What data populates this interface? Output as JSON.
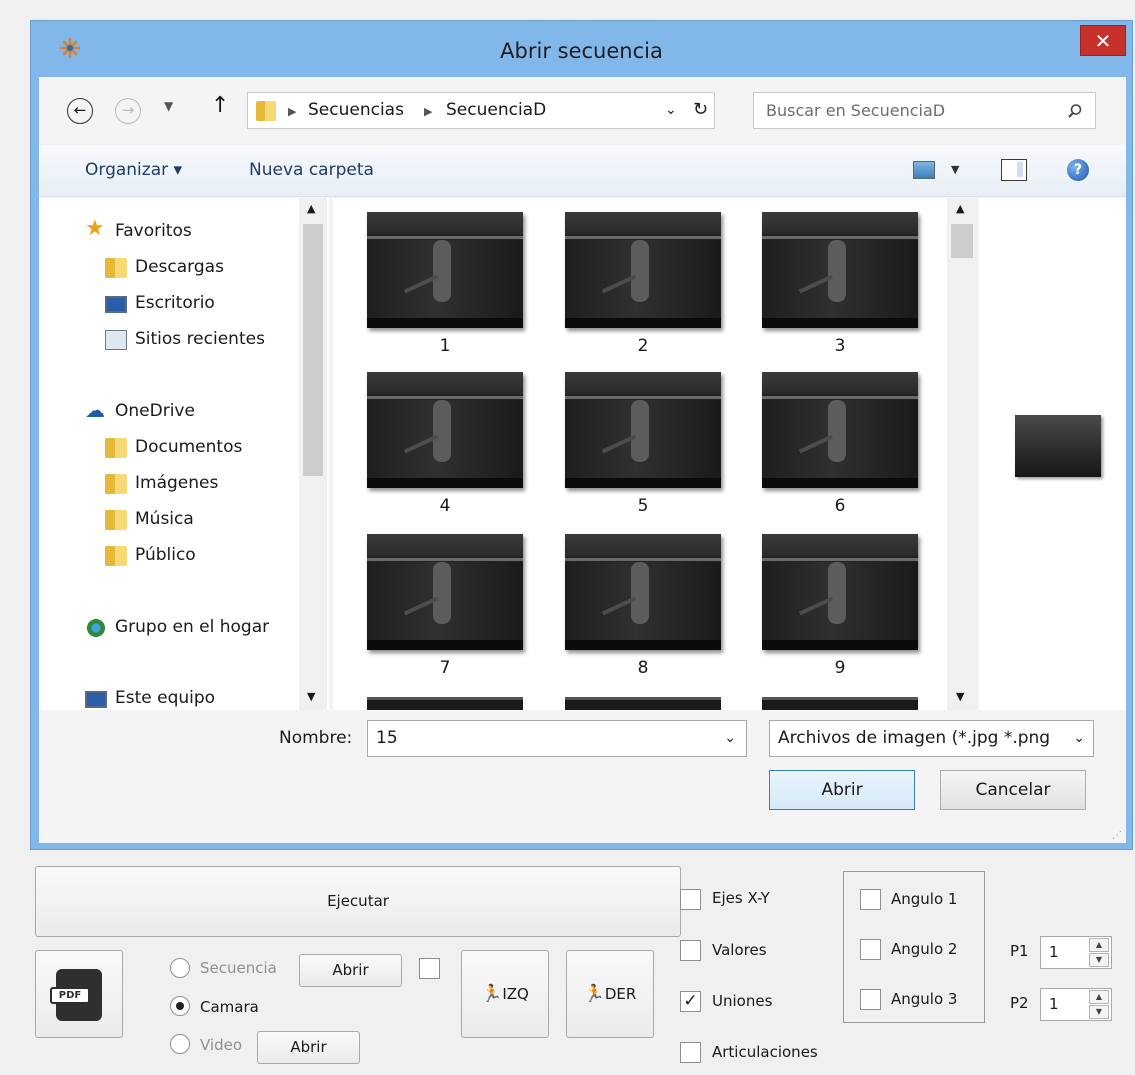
{
  "dialog": {
    "title": "Abrir secuencia",
    "close_label": "✕",
    "breadcrumb": [
      "Secuencias",
      "SecuenciaD"
    ],
    "search": {
      "placeholder": "Buscar en SecuenciaD"
    },
    "toolbar": {
      "organize": "Organizar ▾",
      "new_folder": "Nueva carpeta"
    },
    "nav": {
      "favorites": "Favoritos",
      "downloads": "Descargas",
      "desktop": "Escritorio",
      "recent": "Sitios recientes",
      "onedrive": "OneDrive",
      "documents": "Documentos",
      "images": "Imágenes",
      "music": "Música",
      "public": "Público",
      "homegroup": "Grupo en el hogar",
      "this_pc": "Este equipo"
    },
    "files": [
      "1",
      "2",
      "3",
      "4",
      "5",
      "6",
      "7",
      "8",
      "9"
    ],
    "filename_label": "Nombre:",
    "filename_value": "15",
    "filetype_value": "Archivos de imagen (*.jpg *.png",
    "open_button": "Abrir",
    "cancel_button": "Cancelar"
  },
  "app": {
    "run_button": "Ejecutar",
    "pdf_icon_label": "PDF",
    "sources": [
      {
        "label": "Secuencia",
        "selected": false,
        "enabled": false,
        "open_label": "Abrir"
      },
      {
        "label": "Camara",
        "selected": true,
        "enabled": true
      },
      {
        "label": "Video",
        "selected": false,
        "enabled": false,
        "open_label": "Abrir"
      }
    ],
    "left_button": "IZQ",
    "right_button": "DER",
    "checks": [
      {
        "label": "Ejes X-Y",
        "checked": false
      },
      {
        "label": "Valores",
        "checked": false
      },
      {
        "label": "Uniones",
        "checked": true
      },
      {
        "label": "Articulaciones",
        "checked": false
      }
    ],
    "angles": [
      "Angulo 1",
      "Angulo 2",
      "Angulo 3"
    ],
    "p1_label": "P1",
    "p1_value": "1",
    "p2_label": "P2",
    "p2_value": "1"
  }
}
